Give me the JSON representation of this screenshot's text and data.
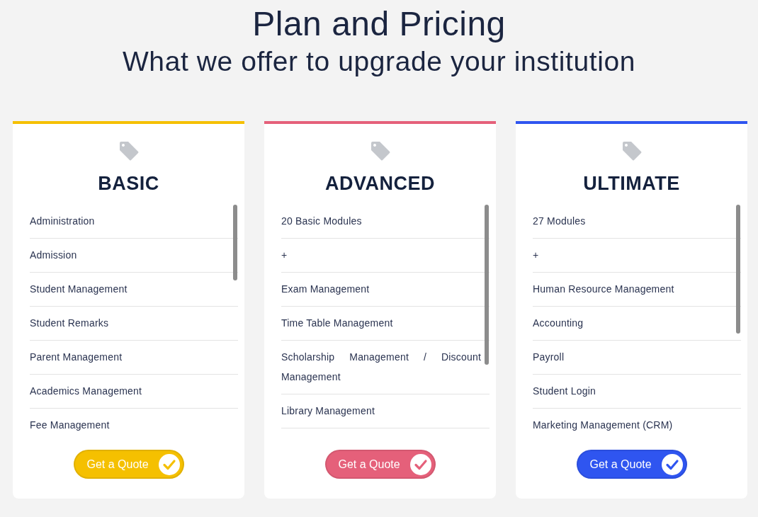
{
  "heading": {
    "title": "Plan and Pricing",
    "subtitle": "What we offer to upgrade your institution"
  },
  "plans": [
    {
      "name": "BASIC",
      "color": "#f5c000",
      "features": [
        "Administration",
        "Admission",
        "Student Management",
        "Student Remarks",
        "Parent Management",
        "Academics Management",
        "Fee Management"
      ],
      "button": "Get a Quote"
    },
    {
      "name": "ADVANCED",
      "color": "#e5607a",
      "features": [
        "20 Basic Modules",
        "+",
        "Exam Management",
        "Time Table Management",
        "Scholarship Management / Discount Management",
        "Library Management"
      ],
      "button": "Get a Quote"
    },
    {
      "name": "ULTIMATE",
      "color": "#2f55f0",
      "features": [
        "27 Modules",
        "+",
        "Human Resource Management",
        "Accounting",
        "Payroll",
        "Student Login",
        "Marketing Management (CRM)"
      ],
      "button": "Get a Quote"
    }
  ]
}
